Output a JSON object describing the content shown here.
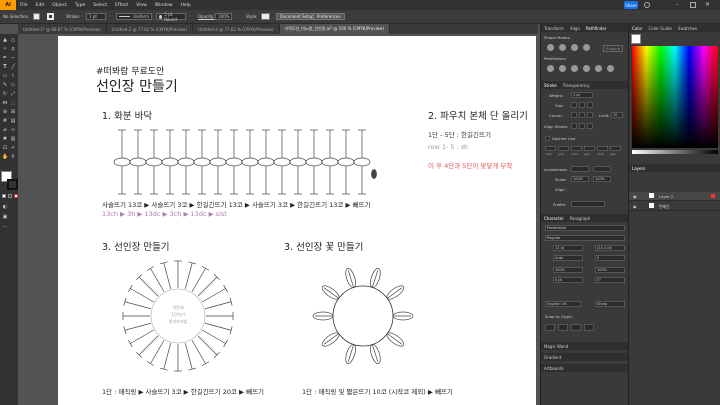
{
  "app": {
    "logo": "Ai",
    "share": "Share"
  },
  "menu": [
    "File",
    "Edit",
    "Object",
    "Type",
    "Select",
    "Effect",
    "View",
    "Window",
    "Help"
  ],
  "control": {
    "selection": "No Selection",
    "stroke_label": "Stroke:",
    "stroke_weight": "1 pt",
    "profile": "Uniform",
    "brush": "5 pt. Round",
    "opacity_label": "Opacity:",
    "opacity": "100%",
    "style_label": "Style:",
    "doc_setup": "Document Setup",
    "preferences": "Preferences"
  },
  "tabs": [
    "Untitled-1* @ 66.67 % (CMYK/Preview)",
    "Untitled-2 @ 77.62 % (CMYK/Preview)",
    "Untitled-3 @ 77.62 % (CMYK/Preview)",
    "기적도안_미뇨원_선인장.ai* @ 100 % (CMYK/Preview)"
  ],
  "artboard": {
    "hashtag": "#떠봐람 무료도안",
    "title": "선인장 만들기",
    "s1_title": "1. 화분 바닥",
    "s1_line1": "사슬뜨기 13코 ▶ 사슬뜨기 3코 ▶ 한길긴뜨기 13코 ▶ 사슬뜨기 3코 ▶ 한길긴뜨기 13코 ▶ 빼뜨기",
    "s1_line2": "13ch ▶ 3h ▶ 13dc ▶ 3ch ▶ 13dc ▶ slst",
    "s2_title": "2. 파우치 본체 단 올리기",
    "s2_line1": "1단 - 5단 : 한길긴뜨기",
    "s2_line2": "row 1- 5 : dc",
    "s2_line3": "이 후 4단과 5단이 맞닿게 부착",
    "s3_title": "3. 선인장 만들기",
    "s3_center": [
      "가운데",
      "1단하기",
      "원리하기법"
    ],
    "s3_bottom": "1단 : 매직링 ▶ 사슬뜨기 3코 ▶ 한길긴뜨기 20코 ▶ 빼뜨기",
    "s4_title": "3. 선인장 꽃 만들기",
    "s4_bottom": "1단 : 매직링 및 짧은뜨기 10코 (시작코 제외) ▶ 빼뜨기"
  },
  "panel": {
    "tabs": [
      "Transform",
      "Align",
      "Pathfinder"
    ],
    "shape_modes": "Shape Modes:",
    "pathfinders": "Pathfinders:",
    "expand": "Expand",
    "stroke_tabs": [
      "Stroke",
      "Transparency"
    ],
    "weight_label": "Weight:",
    "weight": "1 pt",
    "cap_label": "Cap:",
    "corner_label": "Corner:",
    "limit_label": "Limit:",
    "limit": "10",
    "align_label": "Align Stroke:",
    "dashed": "Dashed Line",
    "dash_fields": [
      "dash",
      "gap",
      "dash",
      "gap",
      "dash",
      "gap"
    ],
    "arrowheads": "Arrowheads:",
    "scale": "Scale:",
    "scale1": "100%",
    "scale2": "100%",
    "align2": "Align:",
    "profile": "Profile:",
    "char_tabs": [
      "Character",
      "Paragraph"
    ],
    "font": "Pretendard",
    "style": "Regular",
    "size1": "12 pt",
    "size2": "(14.4 pt)",
    "kern": "Auto",
    "track": "0",
    "hscale": "100%",
    "vscale": "100%",
    "baseline": "0 pt",
    "rotate": "0°",
    "lang": "English: UK",
    "aa": "Sharp",
    "snap": "Snap to Glyph:",
    "magic": "Magic Wand",
    "gradient": "Gradient",
    "artboards": "Artboards"
  },
  "far": {
    "color_tabs": [
      "Color",
      "Color Guide",
      "Swatches"
    ],
    "layers_tab": "Layers",
    "layers": [
      "Layer 2",
      "번째선"
    ]
  },
  "colors": {
    "accent": "#ff9a00",
    "note_red": "#e05757",
    "steps_purple": "#b07ab0",
    "gray_text": "#999999"
  }
}
